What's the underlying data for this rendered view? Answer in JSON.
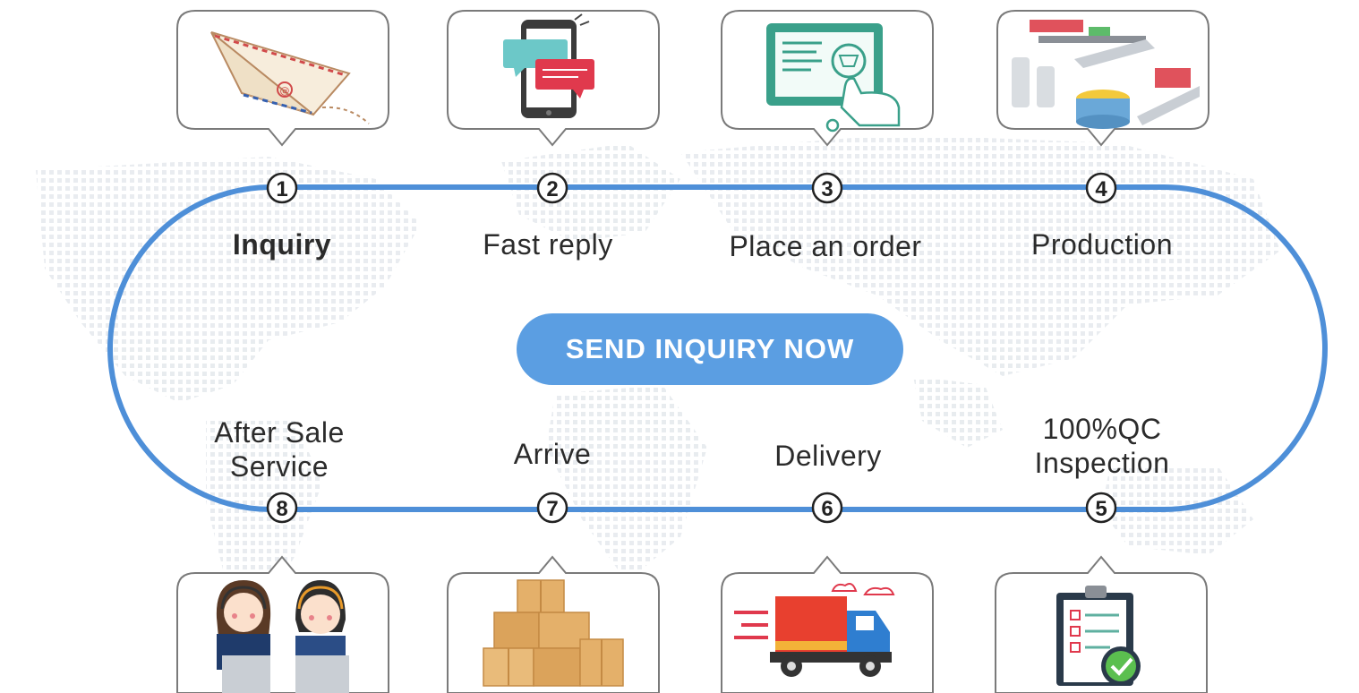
{
  "cta": {
    "label": "SEND INQUIRY NOW"
  },
  "steps": [
    {
      "num": "1",
      "label": "Inquiry",
      "icon": "paper-plane-mail-icon"
    },
    {
      "num": "2",
      "label": "Fast reply",
      "icon": "smartphone-chat-icon"
    },
    {
      "num": "3",
      "label": "Place an order",
      "icon": "monitor-cart-click-icon"
    },
    {
      "num": "4",
      "label": "Production",
      "icon": "factory-line-icon"
    },
    {
      "num": "5",
      "label_line1": "100%QC",
      "label_line2": "Inspection",
      "icon": "checklist-clipboard-icon"
    },
    {
      "num": "6",
      "label": "Delivery",
      "icon": "delivery-truck-icon"
    },
    {
      "num": "7",
      "label": "Arrive",
      "icon": "cardboard-boxes-icon"
    },
    {
      "num": "8",
      "label_line1": "After Sale",
      "label_line2": "Service",
      "icon": "customer-service-agents-icon"
    }
  ],
  "colors": {
    "track": "#4e8fd8",
    "cta_bg": "#5b9ee2",
    "bubble_border": "#7a7a7a",
    "map_dots": "#e7ebef"
  }
}
